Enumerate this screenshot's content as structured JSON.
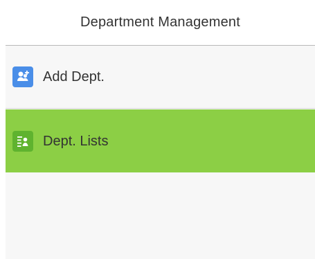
{
  "header": {
    "title": "Department Management"
  },
  "menu": {
    "items": [
      {
        "label": "Add Dept.",
        "icon": "add-user-icon",
        "icon_bg": "#4a8ee8",
        "text_color": "#333333",
        "bg": "#f7f7f7",
        "selected": false
      },
      {
        "label": "Dept. Lists",
        "icon": "department-list-icon",
        "icon_bg": "#5fb32f",
        "text_color": "#333333",
        "bg": "#8ccf45",
        "selected": true
      }
    ]
  },
  "colors": {
    "header_bg": "#ffffff",
    "screen_bg": "#f7f7f7",
    "selected_bg": "#8ccf45"
  }
}
